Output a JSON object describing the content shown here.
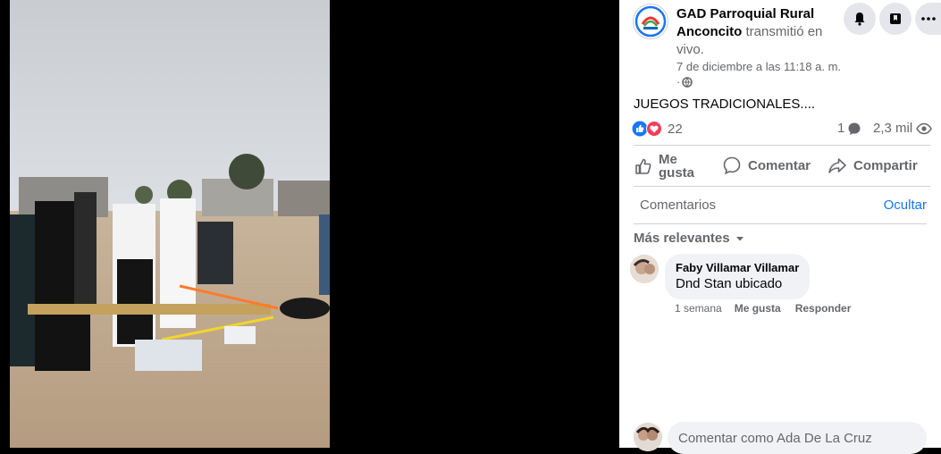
{
  "post": {
    "page_name": "GAD Parroquial Rural Anconcito",
    "action_text": "transmitió en vivo.",
    "timestamp": "7 de diciembre a las 11:18 a. m.",
    "visibility_separator": "·",
    "visibility_icon": "globe-icon",
    "caption": "JUEGOS TRADICIONALES...."
  },
  "reactions": {
    "count": "22",
    "types": [
      "like",
      "love"
    ]
  },
  "stats": {
    "comments_count": "1",
    "views": "2,3 mil"
  },
  "actions": {
    "like": "Me gusta",
    "comment": "Comentar",
    "share": "Compartir"
  },
  "comments_section": {
    "header": "Comentarios",
    "hide": "Ocultar",
    "sort_label": "Más relevantes"
  },
  "comments": [
    {
      "author": "Faby Villamar Villamar",
      "text": "Dnd Stan ubicado",
      "time": "1 semana",
      "like_label": "Me gusta",
      "reply_label": "Responder"
    }
  ],
  "composer": {
    "placeholder": "Comentar como Ada De La Cruz"
  },
  "colors": {
    "accent": "#1877f2",
    "love": "#f33e58",
    "muted": "#65676b"
  }
}
